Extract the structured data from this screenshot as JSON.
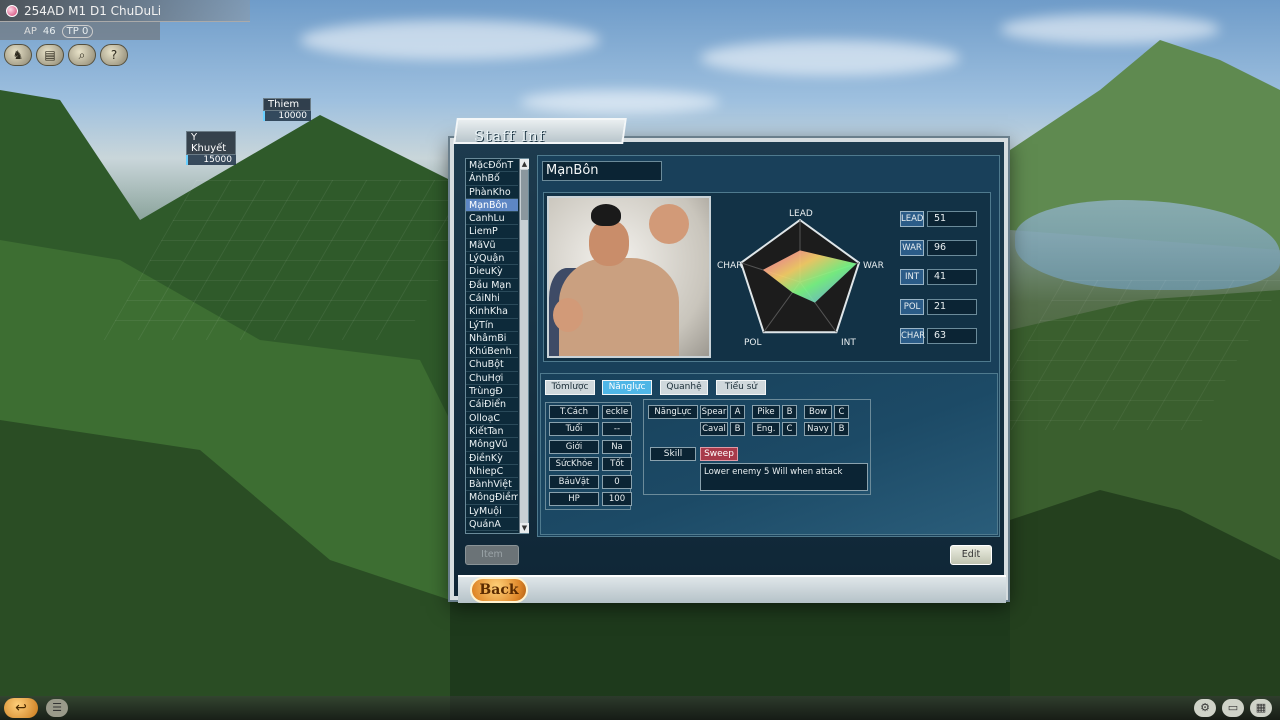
{
  "hud": {
    "date_text": "254AD  M1  D1 ChuDuLi",
    "ap_label": "AP",
    "ap_value": "46",
    "tp_label": "TP",
    "tp_value": "0",
    "icons": [
      "horse-icon",
      "scroll-icon",
      "magnifier-icon",
      "help-icon"
    ]
  },
  "map_units": [
    {
      "name": "Thiem",
      "troops": "10000"
    },
    {
      "name": "Y Khuyết",
      "troops": "15000"
    }
  ],
  "dialog": {
    "title": "Staff Inf",
    "back_label": "Back",
    "item_label": "Item",
    "edit_label": "Edit"
  },
  "officer_list": {
    "selected": "MạnBôn",
    "items": [
      "MặcĐốnT",
      "ÁnhBố",
      "PhànKho",
      "MạnBôn",
      "CanhLu",
      "LiemP",
      "MãVũ",
      "LýQuận",
      "DieuKỳ",
      "Đầu Mạn",
      "CáiNhi",
      "KinhKha",
      "LýTín",
      "NhâmBi",
      "KhúBenh",
      "ChuBột",
      "ChuHợi",
      "TrùngĐ",
      "CáiĐiển",
      "OlloạC",
      "KiếtTan",
      "MôngVũ",
      "ĐiềnKỳ",
      "NhiepC",
      "BànhViệt",
      "MôngĐiềm",
      "LyMuội",
      "QuánA"
    ]
  },
  "officer": {
    "name": "MạnBôn",
    "stats": [
      {
        "key": "LEAD",
        "value": 51
      },
      {
        "key": "WAR",
        "value": 96
      },
      {
        "key": "INT",
        "value": 41
      },
      {
        "key": "POL",
        "value": 21
      },
      {
        "key": "CHAR",
        "value": 63
      }
    ],
    "radar_labels": {
      "lead": "LEAD",
      "war": "WAR",
      "int": "INT",
      "pol": "POL",
      "char": "CHAR"
    }
  },
  "tabs": [
    {
      "label": "Tómlược",
      "active": false
    },
    {
      "label": "Nănglực",
      "active": true
    },
    {
      "label": "Quanhệ",
      "active": false
    },
    {
      "label": "Tiểu sử",
      "active": false
    }
  ],
  "attributes": [
    {
      "key": "T.Cách",
      "value": "eckle"
    },
    {
      "key": "Tuổi",
      "value": "--"
    },
    {
      "key": "Giới",
      "value": "Na"
    },
    {
      "key": "SứcKhỏe",
      "value": "Tốt"
    },
    {
      "key": "BáuVật",
      "value": "0"
    },
    {
      "key": "HP",
      "value": "100"
    }
  ],
  "aptitude": {
    "label": "NăngLực",
    "spear": {
      "label": "Spear",
      "grade": "A"
    },
    "pike": {
      "label": "Pike",
      "grade": "B"
    },
    "bow": {
      "label": "Bow",
      "grade": "C"
    },
    "caval": {
      "label": "Caval",
      "grade": "B"
    },
    "eng": {
      "label": "Eng.",
      "grade": "C"
    },
    "navy": {
      "label": "Navy",
      "grade": "B"
    }
  },
  "skill": {
    "label": "Skill",
    "name": "Sweep",
    "description": "Lower enemy 5 Will when attack"
  },
  "colors": {
    "accent": "#4fb6e6",
    "selected_row": "#5d86c4",
    "skill_bg": "#a83a4a",
    "panel": "#19405a"
  }
}
